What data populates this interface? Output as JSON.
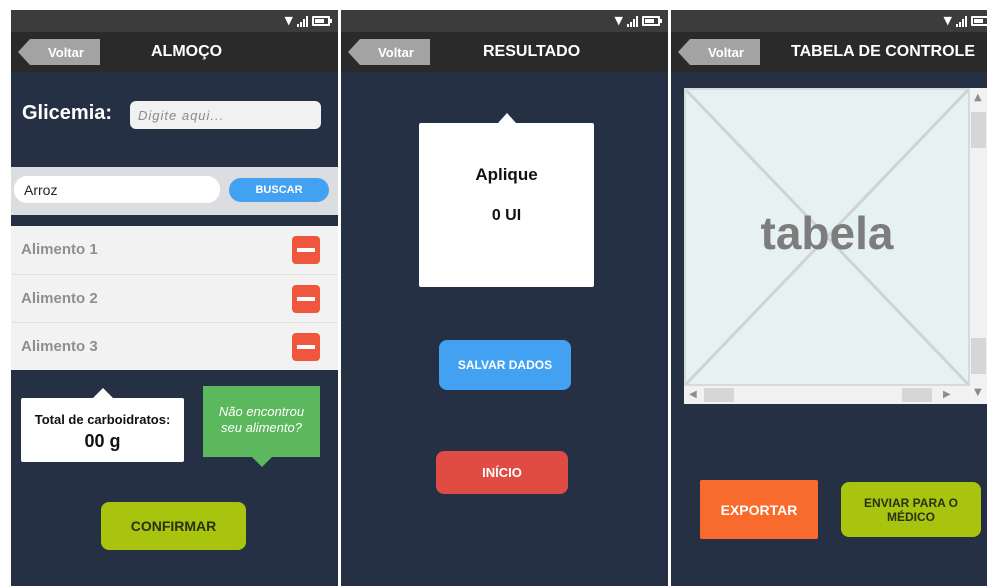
{
  "screens": {
    "almoco": {
      "back_label": "Voltar",
      "title": "ALMOÇO",
      "glicemia_label": "Glicemia:",
      "glicemia_placeholder": "Digite aqui...",
      "search_value": "Arroz",
      "search_button": "BUSCAR",
      "foods": [
        "Alimento 1",
        "Alimento 2",
        "Alimento 3"
      ],
      "carb_title": "Total de carboidratos:",
      "carb_value": "00 g",
      "not_found_line1": "Não encontrou",
      "not_found_line2": "seu alimento?",
      "confirm_button": "CONFIRMAR"
    },
    "resultado": {
      "back_label": "Voltar",
      "title": "RESULTADO",
      "apply_title": "Aplique",
      "apply_value": "0 UI",
      "save_button": "SALVAR DADOS",
      "home_button": "INÍCIO"
    },
    "tabela": {
      "back_label": "Voltar",
      "title": "TABELA DE CONTROLE",
      "table_placeholder": "tabela",
      "export_button": "EXPORTAR",
      "send_line1": "ENVIAR PARA O",
      "send_line2": "MÉDICO"
    }
  },
  "colors": {
    "background": "#253044",
    "appbar": "#2a2a2a",
    "back_button": "#a3a3a3",
    "blue_button": "#42a1f1",
    "red_button": "#e04c43",
    "green_button": "#a8c40f",
    "green_card": "#5cb85c",
    "remove_button": "#f0553e",
    "export_button": "#f96a2d"
  },
  "icons": {
    "status": [
      "wifi-icon",
      "signal-icon",
      "battery-icon"
    ],
    "remove": "minus-icon",
    "scroll": [
      "scroll-up-icon",
      "scroll-down-icon",
      "scroll-left-icon",
      "scroll-right-icon"
    ]
  }
}
